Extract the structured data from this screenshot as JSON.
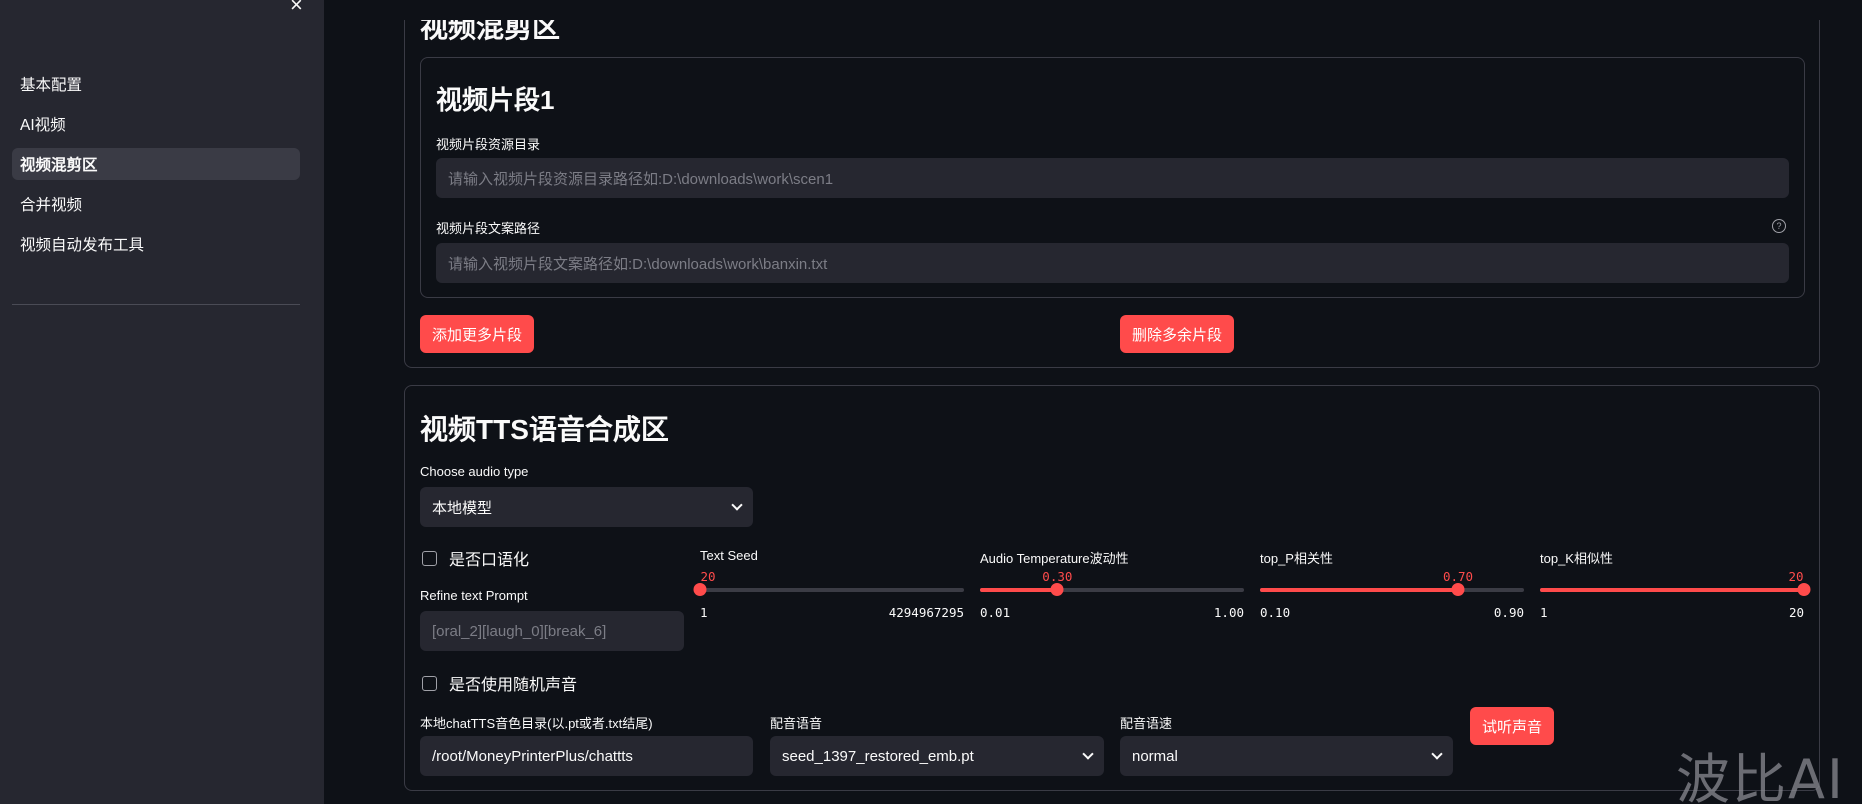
{
  "sidebar": {
    "close_icon": "close-icon",
    "items": [
      {
        "label": "基本配置",
        "active": false
      },
      {
        "label": "AI视频",
        "active": false
      },
      {
        "label": "视频混剪区",
        "active": true
      },
      {
        "label": "合并视频",
        "active": false
      },
      {
        "label": "视频自动发布工具",
        "active": false
      }
    ]
  },
  "mix": {
    "title": "视频混剪区",
    "segment_title": "视频片段1",
    "dir_label": "视频片段资源目录",
    "dir_placeholder": "请输入视频片段资源目录路径如:D:\\downloads\\work\\scen1",
    "copy_label": "视频片段文案路径",
    "copy_placeholder": "请输入视频片段文案路径如:D:\\downloads\\work\\banxin.txt",
    "add_button": "添加更多片段",
    "delete_button": "删除多余片段"
  },
  "tts": {
    "title": "视频TTS语音合成区",
    "audio_type_label": "Choose audio type",
    "audio_type_value": "本地模型",
    "oral_checkbox": "是否口语化",
    "refine_label": "Refine text Prompt",
    "refine_placeholder": "[oral_2][laugh_0][break_6]",
    "random_voice_checkbox": "是否使用随机声音",
    "voice_dir_label": "本地chatTTS音色目录(以.pt或者.txt结尾)",
    "voice_dir_value": "/root/MoneyPrinterPlus/chattts",
    "voice_label": "配音语音",
    "voice_value": "seed_1397_restored_emb.pt",
    "speed_label": "配音语速",
    "speed_value": "normal",
    "listen_button": "试听声音",
    "sliders": [
      {
        "label": "Text Seed",
        "value": "20",
        "min": "1",
        "max": "4294967295",
        "fraction": 0.0
      },
      {
        "label": "Audio Temperature波动性",
        "value": "0.30",
        "min": "0.01",
        "max": "1.00",
        "fraction": 0.293
      },
      {
        "label": "top_P相关性",
        "value": "0.70",
        "min": "0.10",
        "max": "0.90",
        "fraction": 0.75
      },
      {
        "label": "top_K相似性",
        "value": "20",
        "min": "1",
        "max": "20",
        "fraction": 1.0
      }
    ]
  },
  "colors": {
    "accent": "#ff4b4b",
    "background": "#0e1117",
    "sidebar": "#262730"
  },
  "watermark": "波比AI"
}
